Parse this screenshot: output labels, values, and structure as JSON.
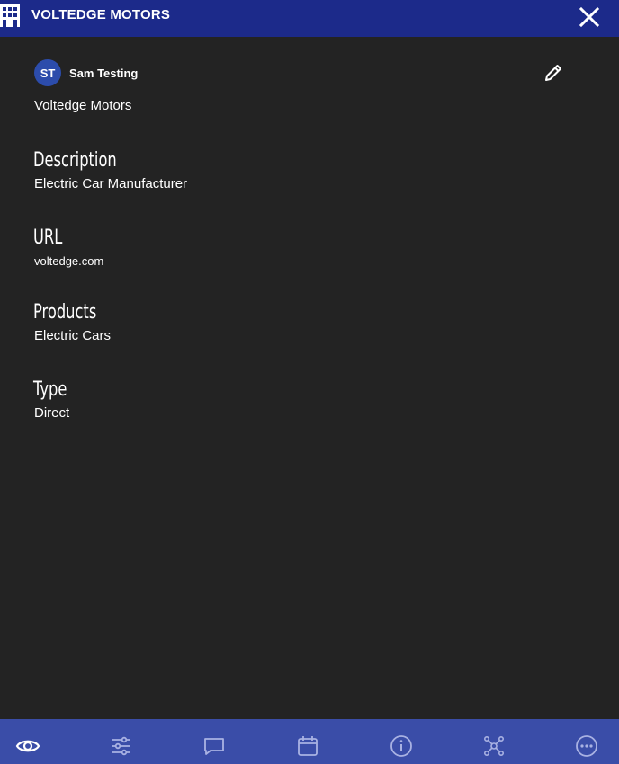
{
  "header": {
    "title": "VOLTEDGE MOTORS",
    "icon": "building-icon",
    "close_icon": "close-icon"
  },
  "user": {
    "initials": "ST",
    "name": "Sam Testing"
  },
  "company_name": "Voltedge Motors",
  "fields": {
    "description": {
      "label": "Description",
      "value": "Electric Car Manufacturer"
    },
    "url": {
      "label": "URL",
      "value": "voltedge.com"
    },
    "products": {
      "label": "Products",
      "value": "Electric Cars"
    },
    "type": {
      "label": "Type",
      "value": "Direct"
    }
  },
  "bottom_nav": [
    {
      "icon": "eye-icon",
      "active": true
    },
    {
      "icon": "sliders-icon",
      "active": false
    },
    {
      "icon": "chat-icon",
      "active": false
    },
    {
      "icon": "calendar-icon",
      "active": false
    },
    {
      "icon": "info-icon",
      "active": false
    },
    {
      "icon": "network-icon",
      "active": false
    },
    {
      "icon": "more-icon",
      "active": false
    }
  ],
  "colors": {
    "header_bg": "#1c2a8a",
    "body_bg": "#232323",
    "bottom_bar_bg": "#3a4da8",
    "avatar_bg": "#2c4cab"
  }
}
